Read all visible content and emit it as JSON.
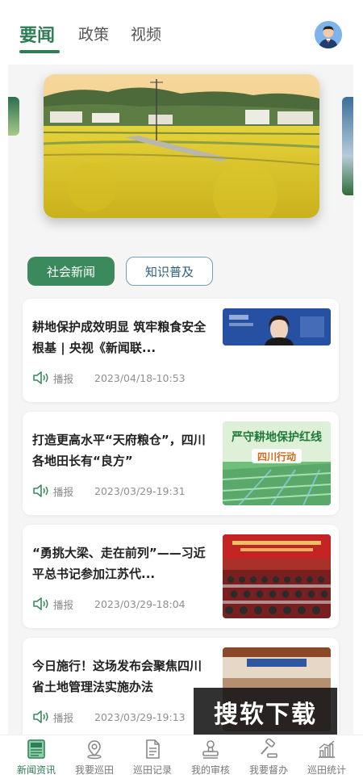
{
  "header": {
    "tabs": [
      {
        "label": "要闻",
        "active": true
      },
      {
        "label": "政策",
        "active": false
      },
      {
        "label": "视频",
        "active": false
      }
    ],
    "accent_color": "#2f7d55"
  },
  "categories": [
    {
      "label": "社会新闻",
      "active": true
    },
    {
      "label": "知识普及",
      "active": false
    }
  ],
  "news": [
    {
      "title": "耕地保护成效明显 筑牢粮食安全根基 | 央视《新闻联...",
      "broadcast": "播报",
      "date": "2023/04/18-10:53"
    },
    {
      "title": "打造更高水平“天府粮仓”，四川各地田长有“良方”",
      "broadcast": "播报",
      "date": "2023/03/29-19:31",
      "thumb_text": {
        "line1": "严守耕地保护红线",
        "line2": "四川行动"
      }
    },
    {
      "title": "“勇挑大梁、走在前列”——习近平总书记参加江苏代...",
      "broadcast": "播报",
      "date": "2023/03/29-18:04"
    },
    {
      "title": "今日施行！这场发布会聚焦四川省土地管理法实施办法",
      "broadcast": "播报",
      "date": "2023/03/29-19:13"
    }
  ],
  "watermark": "搜软下载",
  "bottom_nav": [
    {
      "label": "新闻资讯",
      "icon": "news-icon",
      "active": true
    },
    {
      "label": "我要巡田",
      "icon": "location-icon",
      "active": false
    },
    {
      "label": "巡田记录",
      "icon": "document-icon",
      "active": false
    },
    {
      "label": "我的审核",
      "icon": "stamp-icon",
      "active": false
    },
    {
      "label": "我要督办",
      "icon": "gavel-icon",
      "active": false
    },
    {
      "label": "巡田统计",
      "icon": "chart-icon",
      "active": false
    }
  ]
}
